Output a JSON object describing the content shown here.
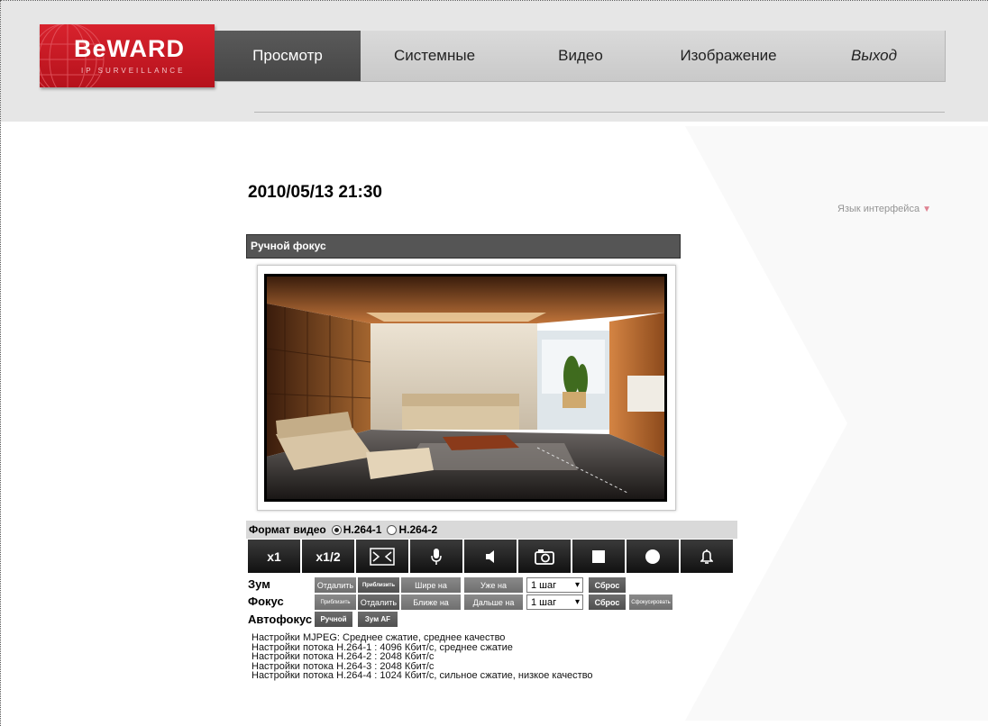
{
  "logo": {
    "brand": "BeWARD",
    "tagline": "IP SURVEILLANCE"
  },
  "nav": {
    "items": [
      {
        "label": "Просмотр",
        "active": true
      },
      {
        "label": "Системные"
      },
      {
        "label": "Видео"
      },
      {
        "label": "Изображение"
      },
      {
        "label": "Выход"
      }
    ]
  },
  "datetime": "2010/05/13 21:30",
  "language_label": "Язык интерфейса",
  "language_arrow": "▼",
  "panel_title": "Ручной фокус",
  "format": {
    "label": "Формат видео",
    "options": [
      {
        "label": "H.264-1",
        "checked": true
      },
      {
        "label": "H.264-2",
        "checked": false
      }
    ]
  },
  "toolbar": {
    "x1": "x1",
    "x12": "x1/2",
    "icons": [
      "fit-screen-icon",
      "microphone-icon",
      "speaker-icon",
      "camera-snapshot-icon",
      "stop-icon",
      "record-icon",
      "alarm-bell-icon"
    ]
  },
  "zoom": {
    "label": "Зум",
    "out": "Отдалить",
    "in": "Приблизить",
    "wider": "Шире на",
    "narrower": "Уже на",
    "step": "1 шаг",
    "reset": "Сброс"
  },
  "focus": {
    "label": "Фокус",
    "near": "Приблизить",
    "far": "Отдалить",
    "closer": "Ближе на",
    "further": "Дальше на",
    "step": "1 шаг",
    "reset": "Сброс",
    "autofocus_now": "Сфокусировать"
  },
  "autofocus": {
    "label": "Автофокус",
    "manual": "Ручной",
    "zoom_af": "Зум AF"
  },
  "stream_info": [
    "Настройки MJPEG: Среднее сжатие, среднее качество",
    "Настройки потока H.264-1 : 4096 Кбит/с, среднее сжатие",
    "Настройки потока H.264-2 : 2048 Кбит/с",
    "Настройки потока H.264-3 : 2048 Кбит/с",
    "Настройки потока H.264-4 : 1024 Кбит/с, сильное сжатие, низкое качество"
  ],
  "colors": {
    "brand_red": "#c8102e",
    "nav_active": "#4f4f4f",
    "nav_bg": "#d2d2d2",
    "toolbar_bg": "#1c1c1c"
  }
}
